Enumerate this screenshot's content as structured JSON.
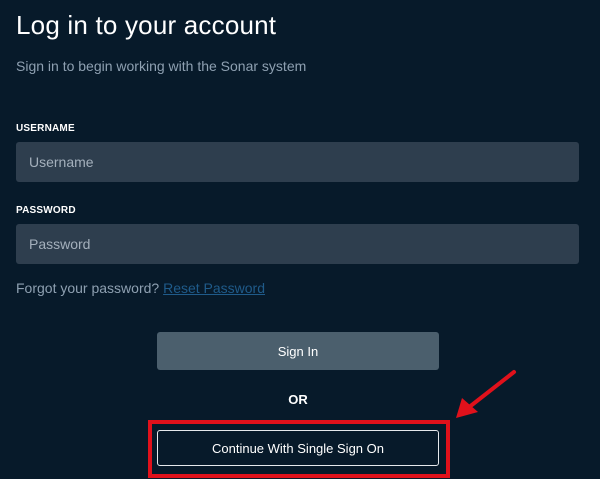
{
  "header": {
    "title": "Log in to your account",
    "subtitle": "Sign in to begin working with the Sonar system"
  },
  "form": {
    "username_label": "USERNAME",
    "username_placeholder": "Username",
    "username_value": "",
    "password_label": "PASSWORD",
    "password_placeholder": "Password",
    "password_value": "",
    "forgot_text": "Forgot your password?",
    "reset_link": "Reset Password"
  },
  "actions": {
    "sign_in_label": "Sign In",
    "or_label": "OR",
    "sso_label": "Continue With Single Sign On"
  },
  "annotation": {
    "color": "#e0111b"
  }
}
